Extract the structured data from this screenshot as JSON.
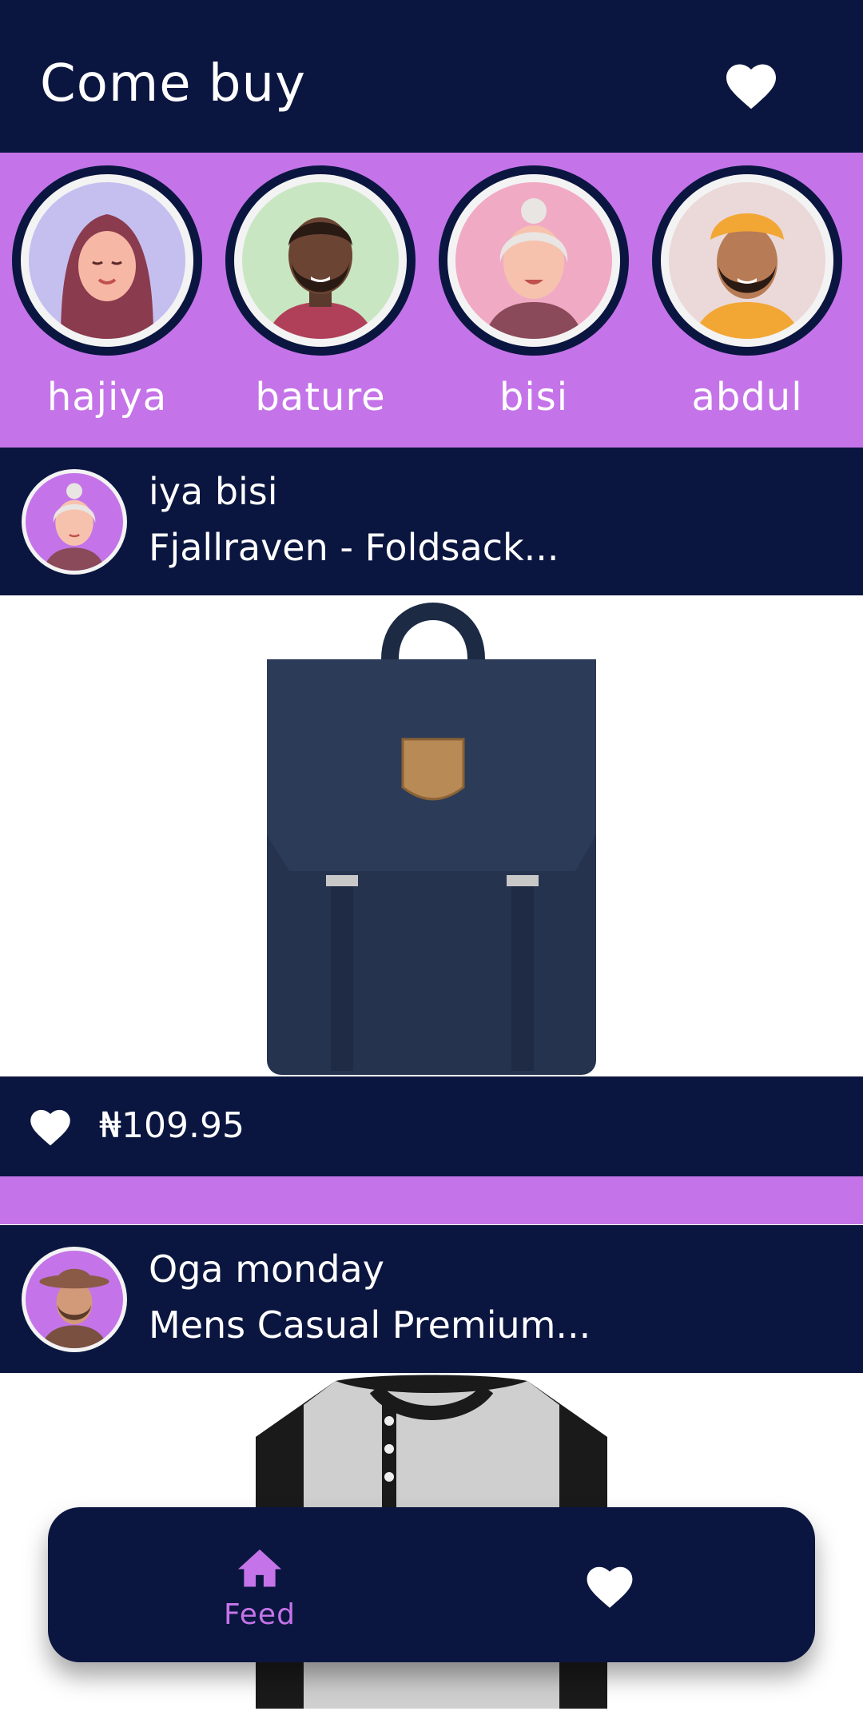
{
  "app": {
    "title": "Come buy",
    "colors": {
      "navy": "#0b1640",
      "purple": "#c474e8",
      "white": "#ffffff"
    }
  },
  "header": {
    "favorites_icon": "heart-icon"
  },
  "stories": [
    {
      "name": "hajiya",
      "bg": "#c5bff0"
    },
    {
      "name": "bature",
      "bg": "#c9e6c3"
    },
    {
      "name": "bisi",
      "bg": "#f1aac4"
    },
    {
      "name": "abdul",
      "bg": "#ead9d8"
    }
  ],
  "posts": [
    {
      "user": "iya bisi",
      "title": "Fjallraven - Foldsack...",
      "price": "₦109.95",
      "like_icon": "heart-icon",
      "image": "navy backpack"
    },
    {
      "user": "Oga monday",
      "title": "Mens Casual Premium...",
      "image": "raglan henley shirt"
    }
  ],
  "bottom_nav": {
    "feed_label": "Feed",
    "feed_icon": "home-icon",
    "favorites_icon": "heart-icon"
  }
}
